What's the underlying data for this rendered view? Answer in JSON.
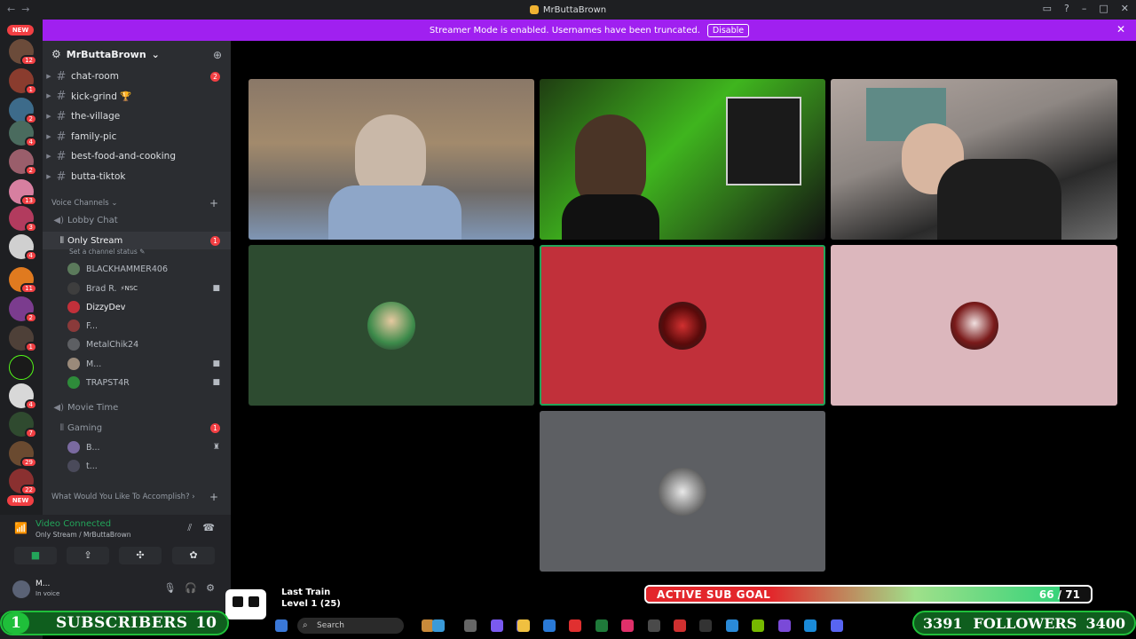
{
  "window": {
    "title": "MrButtaBrown",
    "nav_back": "←",
    "nav_fwd": "→"
  },
  "banner": {
    "text": "Streamer Mode is enabled. Usernames have been truncated.",
    "disable_label": "Disable"
  },
  "server_rail": {
    "new_top": "NEW",
    "new_bottom": "NEW",
    "badges": [
      "12",
      "1",
      "2",
      "4",
      "2",
      "3",
      "13",
      "2",
      "4",
      "11",
      "2",
      "1",
      "4",
      "7",
      "29",
      "22"
    ]
  },
  "server": {
    "name": "MrButtaBrown",
    "chevron": "⌄"
  },
  "text_channels": [
    {
      "name": "chat-room",
      "badge": "2"
    },
    {
      "name": "kick-grind 🏆",
      "badge": ""
    },
    {
      "name": "the-village",
      "badge": ""
    },
    {
      "name": "family-pic",
      "badge": ""
    },
    {
      "name": "best-food-and-cooking",
      "badge": ""
    },
    {
      "name": "butta-tiktok",
      "badge": ""
    }
  ],
  "voice_category": {
    "label": "Voice Channels ⌄",
    "plus": "+"
  },
  "voice_channels": {
    "lobby": "Lobby Chat",
    "only_stream": {
      "name": "Only Stream",
      "badge": "1",
      "status": "Set a channel status ✎"
    },
    "only_stream_users": [
      {
        "name": "BLACKHAMMER406",
        "cam": ""
      },
      {
        "name": "Brad R.",
        "tag": "⚡NSC",
        "cam": "■"
      },
      {
        "name": "DizzyDev",
        "cam": ""
      },
      {
        "name": "F...",
        "cam": ""
      },
      {
        "name": "MetalChik24",
        "cam": ""
      },
      {
        "name": "M...",
        "cam": "■"
      },
      {
        "name": "TRAPST4R",
        "cam": "■"
      }
    ],
    "movie": "Movie Time",
    "gaming": {
      "name": "Gaming",
      "badge": "1"
    },
    "gaming_users": [
      {
        "name": "B...",
        "cam": ""
      },
      {
        "name": "t...",
        "cam": ""
      }
    ]
  },
  "category2": {
    "label": "What Would You Like To Accomplish? ›",
    "plus": "+"
  },
  "voice_panel": {
    "status": "Video Connected",
    "sub": "Only Stream / MrButtaBrown"
  },
  "user_panel": {
    "name": "M...",
    "status": "In voice"
  },
  "song": {
    "title": "Last Train",
    "level": "Level 1 (25)"
  },
  "sub_goal": {
    "label": "ACTIVE SUB GOAL",
    "current": 66,
    "target": 71,
    "count_text": "66 / 71"
  },
  "subscribers": {
    "start": "1",
    "label": "SUBSCRIBERS",
    "goal": "10"
  },
  "followers": {
    "current": "3391",
    "label": "FOLLOWERS",
    "goal": "3400"
  },
  "taskbar": {
    "search_placeholder": "Search"
  },
  "colors": {
    "banner": "#a020f0",
    "tile_green": "#2d4b30",
    "tile_red": "#c1303a",
    "tile_pink": "#dcb7bd",
    "tile_gray": "#5d5f63",
    "connected": "#23a55a"
  },
  "icons": [
    "gear-icon",
    "add-member-icon",
    "hash-icon",
    "speaker-icon",
    "camera-icon",
    "signal-icon",
    "screen-share-icon",
    "activities-icon",
    "soundboard-icon",
    "mic-icon",
    "headphones-icon",
    "settings-icon",
    "search-icon",
    "close-icon"
  ]
}
